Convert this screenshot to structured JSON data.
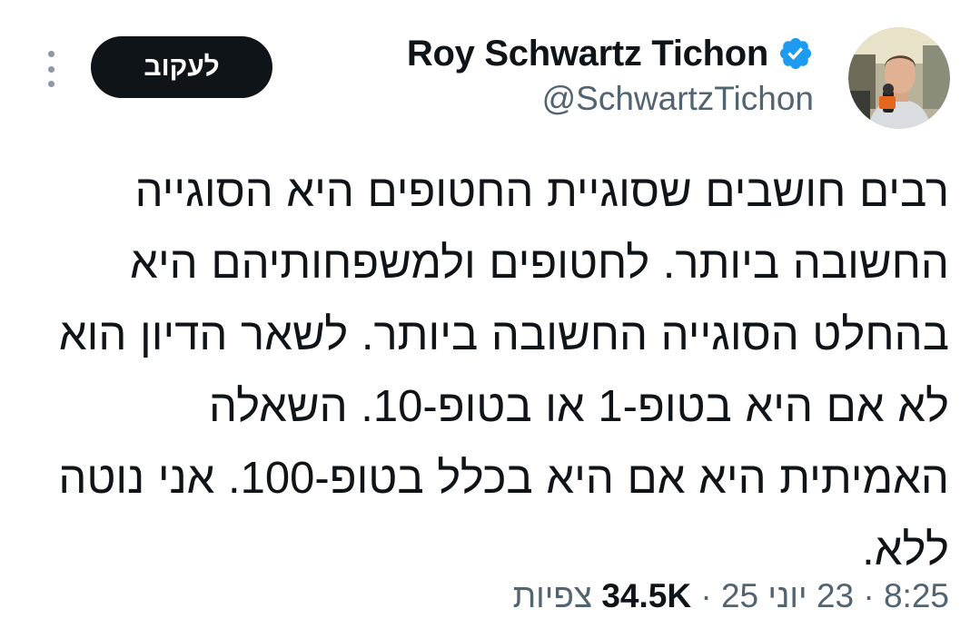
{
  "author": {
    "display_name": "Roy Schwartz Tichon",
    "handle": "@SchwartzTichon",
    "verified": true
  },
  "follow_button_label": "לעקוב",
  "tweet_text": "רבים חושבים שסוגיית החטופים היא הסוגייה החשובה ביותר. לחטופים ולמשפחותיהם היא בהחלט הסוגייה החשובה ביותר. לשאר הדיון הוא לא אם היא בטופ-1 או בטופ-10. השאלה האמיתית היא אם היא בכלל בטופ-100. אני נוטה ללא.",
  "meta": {
    "time": "8:25",
    "separator": "·",
    "date": "23 יוני 25",
    "views_count": "34.5K",
    "views_label": "צפיות"
  },
  "colors": {
    "verified_badge": "#1d9bf0",
    "follow_button_bg": "#0f1419",
    "secondary_text": "#536471"
  },
  "icons": {
    "verified": "verified-badge-icon",
    "more": "more-options-icon"
  }
}
